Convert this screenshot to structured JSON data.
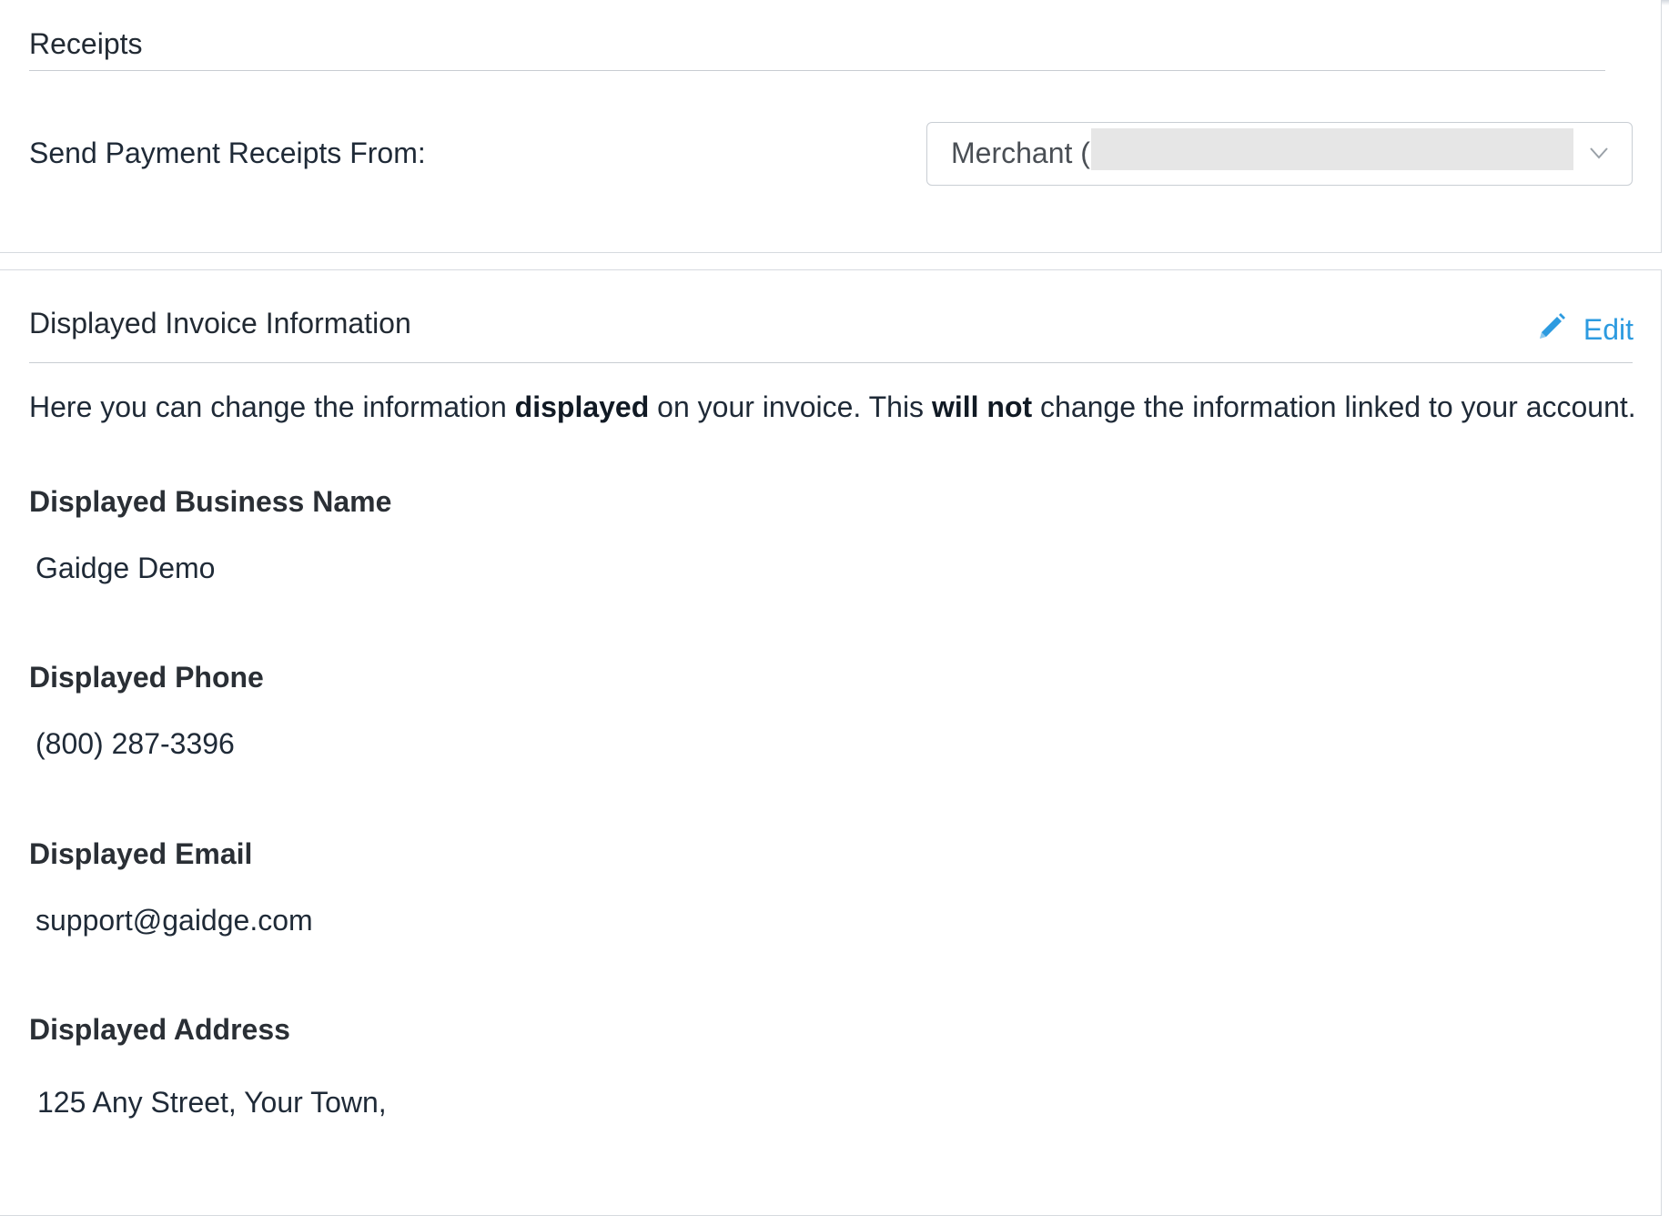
{
  "receipts": {
    "title": "Receipts",
    "send_from_label": "Send Payment Receipts From:",
    "send_from_value": "Merchant ("
  },
  "invoice": {
    "title": "Displayed Invoice Information",
    "edit_label": "Edit",
    "intro": {
      "part1": "Here you can change the information ",
      "bold1": "displayed",
      "part2": " on your invoice. This ",
      "bold2": "will not",
      "part3": " change the information linked to your account."
    },
    "fields": {
      "business_name": {
        "label": "Displayed Business Name",
        "value": "Gaidge Demo"
      },
      "phone": {
        "label": "Displayed Phone",
        "value": "(800) 287-3396"
      },
      "email": {
        "label": "Displayed Email",
        "value": "support@gaidge.com"
      },
      "address": {
        "label": "Displayed Address",
        "value": "125 Any Street, Your Town,"
      }
    }
  },
  "colors": {
    "accent": "#2d9be0",
    "text": "#1f2a37",
    "border": "#d6dadf"
  },
  "icons": {
    "edit": "pencil-icon",
    "select": "chevron-down-icon"
  }
}
